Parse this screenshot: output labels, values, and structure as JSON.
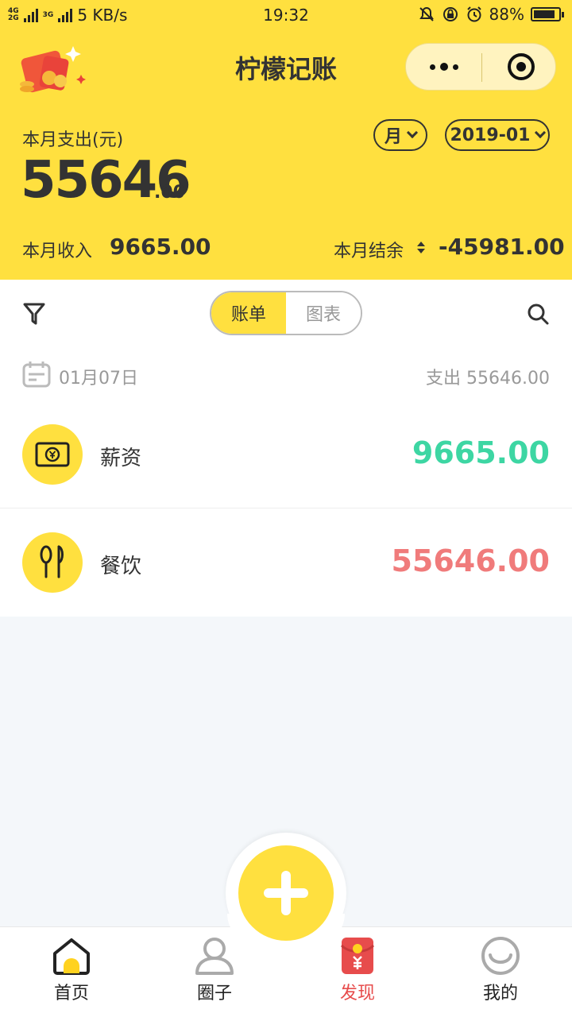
{
  "status_bar": {
    "network_top": "4G",
    "network_bottom": "2G",
    "network_second": "3G",
    "speed": "5 KB/s",
    "time": "19:32",
    "battery": "88%"
  },
  "header": {
    "title": "柠檬记账",
    "expense_label": "本月支出(元)",
    "period_unit": "月",
    "period_date": "2019-01",
    "expense_amount": "55646",
    "expense_decimal": ".00",
    "income_label": "本月收入",
    "income_value": "9665.00",
    "balance_label": "本月结余",
    "balance_value": "-45981.00"
  },
  "segment": {
    "tabs": [
      "账单",
      "图表"
    ],
    "active": "账单"
  },
  "day_group": {
    "date": "01月07日",
    "total": "支出 55646.00"
  },
  "records": [
    {
      "category": "薪资",
      "amount": "9665.00",
      "color": "#3dd6a3",
      "icon": "salary-icon"
    },
    {
      "category": "餐饮",
      "amount": "55646.00",
      "color": "#f07b7b",
      "icon": "dining-icon"
    }
  ],
  "tabbar": {
    "items": [
      {
        "label": "首页",
        "icon": "home-icon"
      },
      {
        "label": "圈子",
        "icon": "circle-icon"
      },
      {
        "label": "发现",
        "icon": "red-envelope-icon"
      },
      {
        "label": "我的",
        "icon": "profile-icon"
      }
    ]
  },
  "colors": {
    "brand_yellow": "#ffe03f",
    "income_green": "#3dd6a3",
    "expense_red": "#f07b7b",
    "discover_red": "#e74c4c"
  }
}
